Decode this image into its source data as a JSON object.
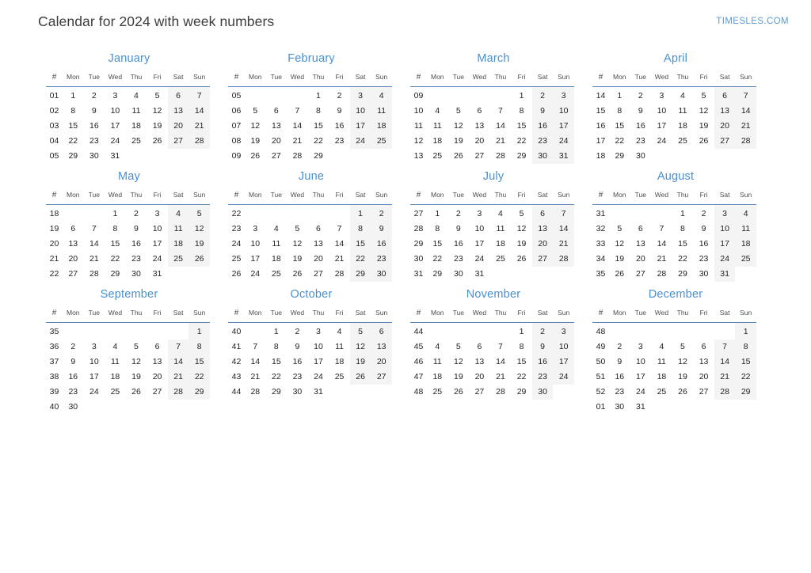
{
  "header": {
    "title": "Calendar for 2024 with week numbers",
    "logo": "TIMESLES.COM"
  },
  "colors": {
    "month_title": "#4a90d0",
    "week_number": "#5b9bd5",
    "header_rule": "#5b86b5",
    "weekend_background": "#f4f4f4",
    "day_text": "#222222",
    "logo": "#5b9bd5",
    "page_title": "#3c3c3c"
  },
  "weekday_headers": [
    "#",
    "Mon",
    "Tue",
    "Wed",
    "Thu",
    "Fri",
    "Sat",
    "Sun"
  ],
  "year": "2024",
  "months": [
    {
      "name": "January",
      "weeks": [
        {
          "week": "01",
          "days": [
            "1",
            "2",
            "3",
            "4",
            "5",
            "6",
            "7"
          ]
        },
        {
          "week": "02",
          "days": [
            "8",
            "9",
            "10",
            "11",
            "12",
            "13",
            "14"
          ]
        },
        {
          "week": "03",
          "days": [
            "15",
            "16",
            "17",
            "18",
            "19",
            "20",
            "21"
          ]
        },
        {
          "week": "04",
          "days": [
            "22",
            "23",
            "24",
            "25",
            "26",
            "27",
            "28"
          ]
        },
        {
          "week": "05",
          "days": [
            "29",
            "30",
            "31",
            "",
            "",
            "",
            ""
          ]
        }
      ]
    },
    {
      "name": "February",
      "weeks": [
        {
          "week": "05",
          "days": [
            "",
            "",
            "",
            "1",
            "2",
            "3",
            "4"
          ]
        },
        {
          "week": "06",
          "days": [
            "5",
            "6",
            "7",
            "8",
            "9",
            "10",
            "11"
          ]
        },
        {
          "week": "07",
          "days": [
            "12",
            "13",
            "14",
            "15",
            "16",
            "17",
            "18"
          ]
        },
        {
          "week": "08",
          "days": [
            "19",
            "20",
            "21",
            "22",
            "23",
            "24",
            "25"
          ]
        },
        {
          "week": "09",
          "days": [
            "26",
            "27",
            "28",
            "29",
            "",
            "",
            ""
          ]
        }
      ]
    },
    {
      "name": "March",
      "weeks": [
        {
          "week": "09",
          "days": [
            "",
            "",
            "",
            "",
            "1",
            "2",
            "3"
          ]
        },
        {
          "week": "10",
          "days": [
            "4",
            "5",
            "6",
            "7",
            "8",
            "9",
            "10"
          ]
        },
        {
          "week": "11",
          "days": [
            "11",
            "12",
            "13",
            "14",
            "15",
            "16",
            "17"
          ]
        },
        {
          "week": "12",
          "days": [
            "18",
            "19",
            "20",
            "21",
            "22",
            "23",
            "24"
          ]
        },
        {
          "week": "13",
          "days": [
            "25",
            "26",
            "27",
            "28",
            "29",
            "30",
            "31"
          ]
        }
      ]
    },
    {
      "name": "April",
      "weeks": [
        {
          "week": "14",
          "days": [
            "1",
            "2",
            "3",
            "4",
            "5",
            "6",
            "7"
          ]
        },
        {
          "week": "15",
          "days": [
            "8",
            "9",
            "10",
            "11",
            "12",
            "13",
            "14"
          ]
        },
        {
          "week": "16",
          "days": [
            "15",
            "16",
            "17",
            "18",
            "19",
            "20",
            "21"
          ]
        },
        {
          "week": "17",
          "days": [
            "22",
            "23",
            "24",
            "25",
            "26",
            "27",
            "28"
          ]
        },
        {
          "week": "18",
          "days": [
            "29",
            "30",
            "",
            "",
            "",
            "",
            ""
          ]
        }
      ]
    },
    {
      "name": "May",
      "weeks": [
        {
          "week": "18",
          "days": [
            "",
            "",
            "1",
            "2",
            "3",
            "4",
            "5"
          ]
        },
        {
          "week": "19",
          "days": [
            "6",
            "7",
            "8",
            "9",
            "10",
            "11",
            "12"
          ]
        },
        {
          "week": "20",
          "days": [
            "13",
            "14",
            "15",
            "16",
            "17",
            "18",
            "19"
          ]
        },
        {
          "week": "21",
          "days": [
            "20",
            "21",
            "22",
            "23",
            "24",
            "25",
            "26"
          ]
        },
        {
          "week": "22",
          "days": [
            "27",
            "28",
            "29",
            "30",
            "31",
            "",
            ""
          ]
        }
      ]
    },
    {
      "name": "June",
      "weeks": [
        {
          "week": "22",
          "days": [
            "",
            "",
            "",
            "",
            "",
            "1",
            "2"
          ]
        },
        {
          "week": "23",
          "days": [
            "3",
            "4",
            "5",
            "6",
            "7",
            "8",
            "9"
          ]
        },
        {
          "week": "24",
          "days": [
            "10",
            "11",
            "12",
            "13",
            "14",
            "15",
            "16"
          ]
        },
        {
          "week": "25",
          "days": [
            "17",
            "18",
            "19",
            "20",
            "21",
            "22",
            "23"
          ]
        },
        {
          "week": "26",
          "days": [
            "24",
            "25",
            "26",
            "27",
            "28",
            "29",
            "30"
          ]
        }
      ]
    },
    {
      "name": "July",
      "weeks": [
        {
          "week": "27",
          "days": [
            "1",
            "2",
            "3",
            "4",
            "5",
            "6",
            "7"
          ]
        },
        {
          "week": "28",
          "days": [
            "8",
            "9",
            "10",
            "11",
            "12",
            "13",
            "14"
          ]
        },
        {
          "week": "29",
          "days": [
            "15",
            "16",
            "17",
            "18",
            "19",
            "20",
            "21"
          ]
        },
        {
          "week": "30",
          "days": [
            "22",
            "23",
            "24",
            "25",
            "26",
            "27",
            "28"
          ]
        },
        {
          "week": "31",
          "days": [
            "29",
            "30",
            "31",
            "",
            "",
            "",
            ""
          ]
        }
      ]
    },
    {
      "name": "August",
      "weeks": [
        {
          "week": "31",
          "days": [
            "",
            "",
            "",
            "1",
            "2",
            "3",
            "4"
          ]
        },
        {
          "week": "32",
          "days": [
            "5",
            "6",
            "7",
            "8",
            "9",
            "10",
            "11"
          ]
        },
        {
          "week": "33",
          "days": [
            "12",
            "13",
            "14",
            "15",
            "16",
            "17",
            "18"
          ]
        },
        {
          "week": "34",
          "days": [
            "19",
            "20",
            "21",
            "22",
            "23",
            "24",
            "25"
          ]
        },
        {
          "week": "35",
          "days": [
            "26",
            "27",
            "28",
            "29",
            "30",
            "31",
            ""
          ]
        }
      ]
    },
    {
      "name": "September",
      "weeks": [
        {
          "week": "35",
          "days": [
            "",
            "",
            "",
            "",
            "",
            "",
            "1"
          ]
        },
        {
          "week": "36",
          "days": [
            "2",
            "3",
            "4",
            "5",
            "6",
            "7",
            "8"
          ]
        },
        {
          "week": "37",
          "days": [
            "9",
            "10",
            "11",
            "12",
            "13",
            "14",
            "15"
          ]
        },
        {
          "week": "38",
          "days": [
            "16",
            "17",
            "18",
            "19",
            "20",
            "21",
            "22"
          ]
        },
        {
          "week": "39",
          "days": [
            "23",
            "24",
            "25",
            "26",
            "27",
            "28",
            "29"
          ]
        },
        {
          "week": "40",
          "days": [
            "30",
            "",
            "",
            "",
            "",
            "",
            ""
          ]
        }
      ]
    },
    {
      "name": "October",
      "weeks": [
        {
          "week": "40",
          "days": [
            "",
            "1",
            "2",
            "3",
            "4",
            "5",
            "6"
          ]
        },
        {
          "week": "41",
          "days": [
            "7",
            "8",
            "9",
            "10",
            "11",
            "12",
            "13"
          ]
        },
        {
          "week": "42",
          "days": [
            "14",
            "15",
            "16",
            "17",
            "18",
            "19",
            "20"
          ]
        },
        {
          "week": "43",
          "days": [
            "21",
            "22",
            "23",
            "24",
            "25",
            "26",
            "27"
          ]
        },
        {
          "week": "44",
          "days": [
            "28",
            "29",
            "30",
            "31",
            "",
            "",
            ""
          ]
        }
      ]
    },
    {
      "name": "November",
      "weeks": [
        {
          "week": "44",
          "days": [
            "",
            "",
            "",
            "",
            "1",
            "2",
            "3"
          ]
        },
        {
          "week": "45",
          "days": [
            "4",
            "5",
            "6",
            "7",
            "8",
            "9",
            "10"
          ]
        },
        {
          "week": "46",
          "days": [
            "11",
            "12",
            "13",
            "14",
            "15",
            "16",
            "17"
          ]
        },
        {
          "week": "47",
          "days": [
            "18",
            "19",
            "20",
            "21",
            "22",
            "23",
            "24"
          ]
        },
        {
          "week": "48",
          "days": [
            "25",
            "26",
            "27",
            "28",
            "29",
            "30",
            ""
          ]
        }
      ]
    },
    {
      "name": "December",
      "weeks": [
        {
          "week": "48",
          "days": [
            "",
            "",
            "",
            "",
            "",
            "",
            "1"
          ]
        },
        {
          "week": "49",
          "days": [
            "2",
            "3",
            "4",
            "5",
            "6",
            "7",
            "8"
          ]
        },
        {
          "week": "50",
          "days": [
            "9",
            "10",
            "11",
            "12",
            "13",
            "14",
            "15"
          ]
        },
        {
          "week": "51",
          "days": [
            "16",
            "17",
            "18",
            "19",
            "20",
            "21",
            "22"
          ]
        },
        {
          "week": "52",
          "days": [
            "23",
            "24",
            "25",
            "26",
            "27",
            "28",
            "29"
          ]
        },
        {
          "week": "01",
          "days": [
            "30",
            "31",
            "",
            "",
            "",
            "",
            ""
          ]
        }
      ]
    }
  ]
}
